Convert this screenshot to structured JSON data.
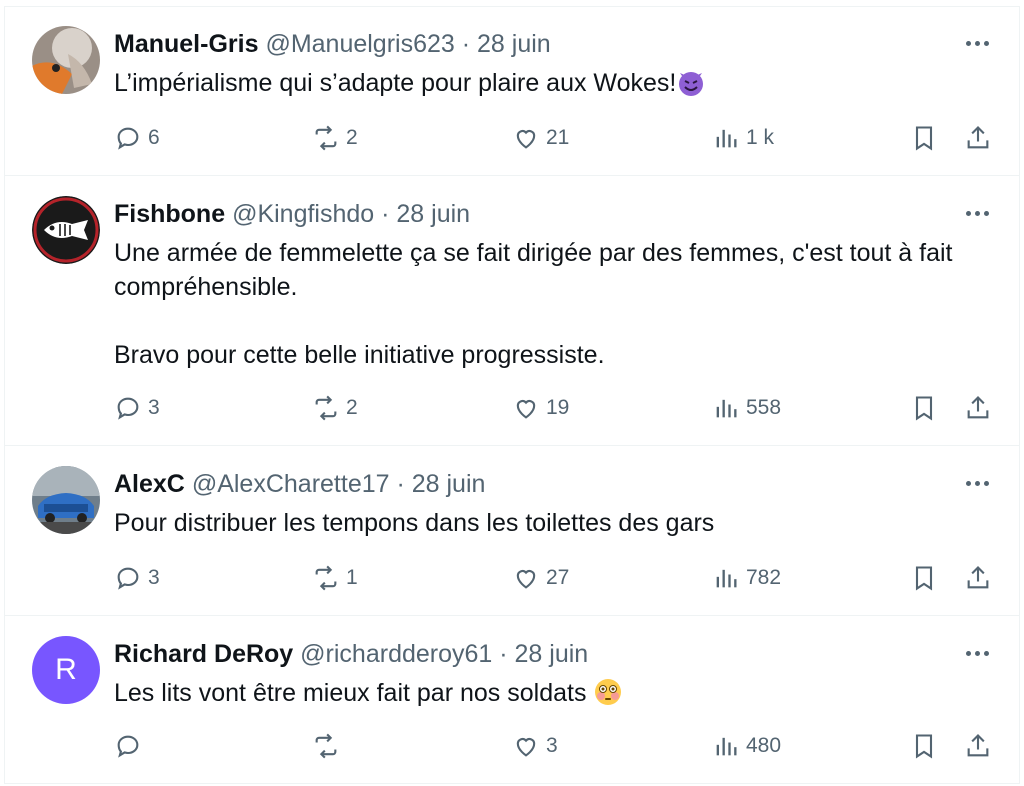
{
  "colors": {
    "text": "#0f1419",
    "secondary": "#536471",
    "border": "#eff3f4",
    "avatar_r": "#7856ff"
  },
  "replies": [
    {
      "name": "Manuel-Gris",
      "meta": "@Manuelgris623 · 28 juin",
      "text": "L’impérialisme qui s’adapte pour plaire aux Wokes!",
      "emoji": "smiling-devil-emoji",
      "stats": {
        "replies": "6",
        "reposts": "2",
        "likes": "21",
        "views": "1 k"
      }
    },
    {
      "name": "Fishbone",
      "meta": "@Kingfishdo · 28 juin",
      "text": "Une armée de femmelette ça se fait dirigée par des femmes, c'est tout à fait compréhensible.\n\nBravo pour cette belle initiative progressiste.",
      "stats": {
        "replies": "3",
        "reposts": "2",
        "likes": "19",
        "views": "558"
      }
    },
    {
      "name": "AlexC",
      "meta": "@AlexCharette17 · 28 juin",
      "text": "Pour distribuer les tempons dans les toilettes des gars",
      "stats": {
        "replies": "3",
        "reposts": "1",
        "likes": "27",
        "views": "782"
      }
    },
    {
      "name": "Richard DeRoy",
      "meta": "@richardderoy61 · 28 juin",
      "avatar_letter": "R",
      "text": "Les lits vont être mieux fait par nos soldats",
      "emoji": "flushed-face-emoji",
      "stats": {
        "replies": "",
        "reposts": "",
        "likes": "3",
        "views": "480"
      }
    }
  ]
}
